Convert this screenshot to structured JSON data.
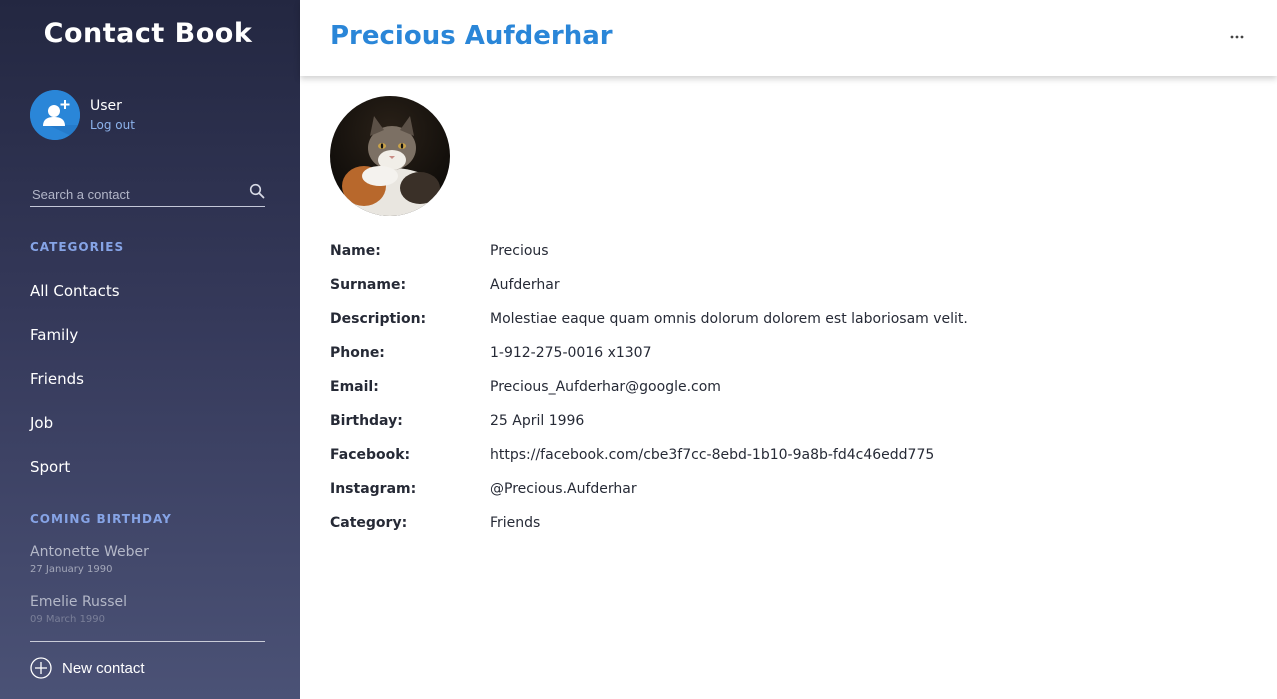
{
  "app": {
    "title": "Contact Book"
  },
  "user": {
    "name": "User",
    "logout_label": "Log out"
  },
  "search": {
    "placeholder": "Search a contact",
    "value": ""
  },
  "categories": {
    "heading": "CATEGORIES",
    "items": [
      {
        "label": "All Contacts"
      },
      {
        "label": "Family"
      },
      {
        "label": "Friends"
      },
      {
        "label": "Job"
      },
      {
        "label": "Sport"
      }
    ]
  },
  "birthdays": {
    "heading": "COMING BIRTHDAY",
    "items": [
      {
        "name": "Antonette Weber",
        "date": "27 January 1990"
      },
      {
        "name": "Emelie Russel",
        "date": "09 March 1990"
      }
    ]
  },
  "new_contact": {
    "label": "New contact"
  },
  "contact": {
    "title": "Precious Aufderhar",
    "fields": [
      {
        "key": "Name:",
        "value": "Precious"
      },
      {
        "key": "Surname:",
        "value": "Aufderhar"
      },
      {
        "key": "Description:",
        "value": "Molestiae eaque quam omnis dolorum dolorem est laboriosam velit."
      },
      {
        "key": "Phone:",
        "value": "1-912-275-0016 x1307"
      },
      {
        "key": "Email:",
        "value": "Precious_Aufderhar@google.com"
      },
      {
        "key": "Birthday:",
        "value": "25 April 1996"
      },
      {
        "key": "Facebook:",
        "value": "https://facebook.com/cbe3f7cc-8ebd-1b10-9a8b-fd4c46edd775"
      },
      {
        "key": "Instagram:",
        "value": "@Precious.Aufderhar"
      },
      {
        "key": "Category:",
        "value": "Friends"
      }
    ]
  },
  "colors": {
    "accent": "#2a86d8",
    "sidebar_top": "#232741",
    "sidebar_bottom": "#4b5276",
    "section_label": "#86a4e6"
  },
  "icons": {
    "avatar": "user-plus-icon",
    "search": "search-icon",
    "more": "more-horizontal-icon",
    "new_contact": "plus-circle-icon"
  }
}
